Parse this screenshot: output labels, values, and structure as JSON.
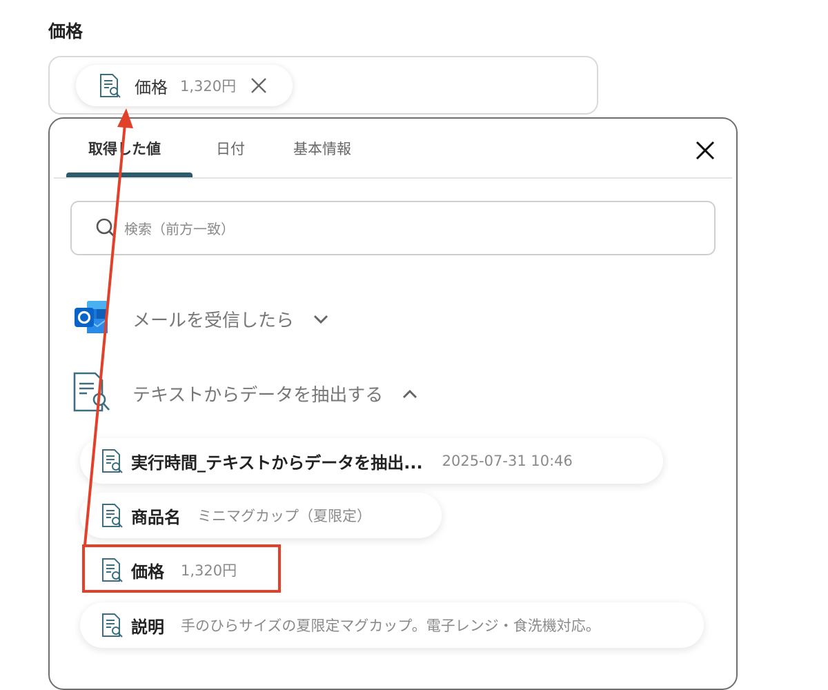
{
  "field": {
    "label": "価格",
    "chip": {
      "label": "価格",
      "value": "1,320円",
      "icon": "doc-search-icon",
      "remove_icon": "close-icon"
    }
  },
  "panel": {
    "tabs": [
      {
        "label": "取得した値",
        "active": true
      },
      {
        "label": "日付",
        "active": false
      },
      {
        "label": "基本情報",
        "active": false
      }
    ],
    "close_icon": "close-icon",
    "search": {
      "placeholder": "検索（前方一致）",
      "icon": "search-icon"
    },
    "sections": [
      {
        "title": "メールを受信したら",
        "icon": "outlook-icon",
        "expanded": false
      },
      {
        "title": "テキストからデータを抽出する",
        "icon": "doc-search-icon",
        "expanded": true,
        "items": [
          {
            "label": "実行時間_テキストからデータを抽出...",
            "value": "2025-07-31 10:46"
          },
          {
            "label": "商品名",
            "value": "ミニマグカップ（夏限定）"
          },
          {
            "label": "価格",
            "value": "1,320円",
            "highlighted": true
          },
          {
            "label": "説明",
            "value": "手のひらサイズの夏限定マグカップ。電子レンジ・食洗機対応。"
          }
        ]
      }
    ]
  },
  "colors": {
    "accent": "#2e5a6e",
    "highlight": "#e1412a",
    "outlook_blue": "#0a64c8"
  }
}
